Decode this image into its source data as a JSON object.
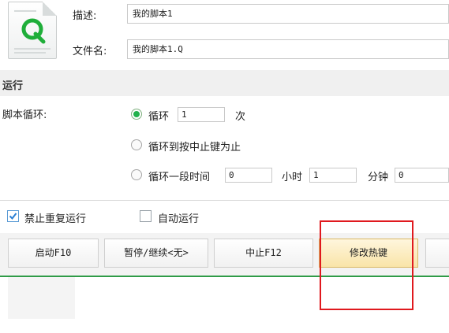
{
  "script_info": {
    "description_label": "描述:",
    "description_value": "我的脚本1",
    "filename_label": "文件名:",
    "filename_value": "我的脚本1.Q"
  },
  "run_section": {
    "title": "运行",
    "loop_label": "脚本循环:",
    "option_loop": {
      "label": "循环",
      "count": "1",
      "unit": "次",
      "selected": true
    },
    "option_until_stop": {
      "label": "循环到按中止键为止",
      "selected": false
    },
    "option_time": {
      "label": "循环一段时间",
      "hours_value": "0",
      "hours_unit": "小时",
      "minutes_value": "1",
      "minutes_unit": "分钟",
      "seconds_value": "0",
      "selected": false
    }
  },
  "options": {
    "no_repeat_label": "禁止重复运行",
    "no_repeat_checked": true,
    "auto_run_label": "自动运行",
    "auto_run_checked": false
  },
  "toolbar": {
    "start_label": "启动F10",
    "pause_label": "暂停/继续<无>",
    "stop_label": "中止F12",
    "hotkey_label": "修改热键"
  },
  "icons": {
    "file": "script-file-icon",
    "radio_selected": "radio-selected",
    "checkbox_checked": "checkmark-icon"
  },
  "colors": {
    "accent_green": "#22b14c",
    "highlight_red": "#e0191e",
    "active_button": "#f9e4a8"
  }
}
